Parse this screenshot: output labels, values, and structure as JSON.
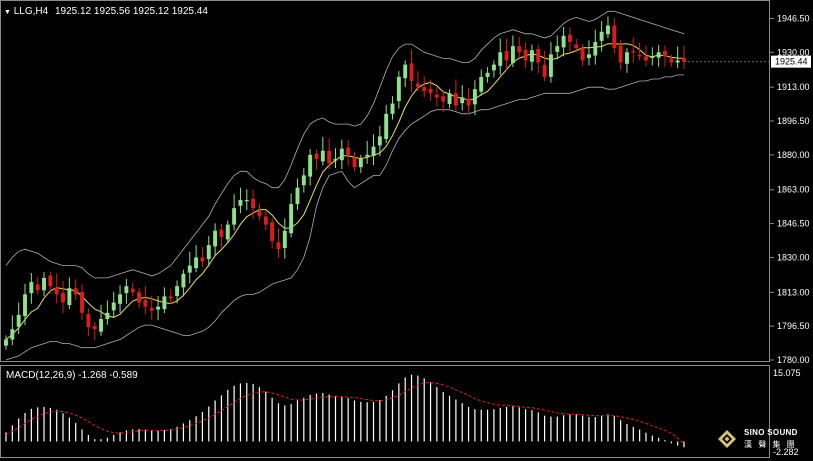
{
  "header": {
    "symbol": "LLG,H4",
    "ohlc": "1925.12 1925.56 1925.12 1925.44",
    "macd_label": "MACD(12,26,9) -1.268 -0.589"
  },
  "colors": {
    "background": "#000000",
    "grid": "#3a3a3a",
    "bull": "#8fe08f",
    "bear": "#d91c1c",
    "ma": "#e8e060",
    "bands": "#b0b0b0",
    "macd_hist": "#ffffff",
    "macd_signal": "#e02020",
    "text": "#ffffff",
    "price_tag_bg": "#ffffff",
    "price_tag_text": "#000000"
  },
  "logo": {
    "line1": "SINO SOUND",
    "line2": "漢 聲 集 團"
  },
  "chart_data": [
    {
      "type": "candlestick",
      "title": "LLG,H4",
      "ylim": [
        1780.0,
        1955.0
      ],
      "y_ticks": [
        "1946.50",
        "1930.00",
        "1913.00",
        "1896.50",
        "1880.00",
        "1863.00",
        "1846.50",
        "1830.00",
        "1813.00",
        "1796.50",
        "1780.00"
      ],
      "current_price": "1925.44",
      "indicators": [
        "Bollinger Bands",
        "Moving Average"
      ],
      "close": [
        1790,
        1795,
        1802,
        1812,
        1818,
        1814,
        1820,
        1816,
        1812,
        1808,
        1815,
        1812,
        1803,
        1796,
        1795,
        1800,
        1803,
        1808,
        1812,
        1816,
        1813,
        1808,
        1806,
        1804,
        1806,
        1811,
        1810,
        1816,
        1822,
        1826,
        1830,
        1828,
        1836,
        1843,
        1840,
        1846,
        1854,
        1858,
        1858,
        1854,
        1850,
        1846,
        1838,
        1834,
        1843,
        1856,
        1864,
        1870,
        1880,
        1878,
        1882,
        1876,
        1878,
        1883,
        1880,
        1874,
        1878,
        1880,
        1884,
        1889,
        1900,
        1905,
        1918,
        1924,
        1916,
        1913,
        1911,
        1910,
        1908,
        1906,
        1910,
        1904,
        1908,
        1904,
        1912,
        1918,
        1920,
        1924,
        1930,
        1926,
        1933,
        1930,
        1926,
        1931,
        1925,
        1918,
        1929,
        1933,
        1938,
        1935,
        1932,
        1926,
        1929,
        1935,
        1940,
        1943,
        1932,
        1925,
        1930,
        1930,
        1928,
        1926,
        1928,
        1930,
        1928,
        1925,
        1926,
        1925.44
      ],
      "bb_upper": [
        1826,
        1830,
        1833,
        1834,
        1833,
        1832,
        1830,
        1828,
        1827,
        1826,
        1826,
        1826,
        1825,
        1822,
        1820,
        1820,
        1820,
        1821,
        1822,
        1823,
        1824,
        1823,
        1822,
        1821,
        1822,
        1824,
        1826,
        1830,
        1834,
        1838,
        1842,
        1846,
        1850,
        1856,
        1861,
        1866,
        1870,
        1872,
        1872,
        1869,
        1867,
        1866,
        1864,
        1864,
        1868,
        1875,
        1883,
        1890,
        1895,
        1897,
        1898,
        1896,
        1895,
        1895,
        1895,
        1894,
        1895,
        1899,
        1905,
        1913,
        1921,
        1928,
        1932,
        1934,
        1934,
        1932,
        1930,
        1929,
        1928,
        1927,
        1927,
        1926,
        1925,
        1925,
        1927,
        1931,
        1934,
        1937,
        1939,
        1940,
        1941,
        1940,
        1939,
        1939,
        1938,
        1937,
        1938,
        1941,
        1944,
        1946,
        1947,
        1946,
        1945,
        1946,
        1948,
        1950,
        1950,
        1949,
        1948,
        1947,
        1946,
        1945,
        1944,
        1943,
        1942,
        1941,
        1940,
        1939
      ],
      "bb_lower": [
        1780,
        1781,
        1782,
        1784,
        1786,
        1787,
        1788,
        1789,
        1789,
        1788,
        1788,
        1787,
        1786,
        1786,
        1786,
        1787,
        1788,
        1789,
        1790,
        1792,
        1794,
        1796,
        1797,
        1797,
        1796,
        1795,
        1794,
        1793,
        1792,
        1792,
        1793,
        1794,
        1796,
        1799,
        1803,
        1806,
        1809,
        1811,
        1812,
        1812,
        1813,
        1815,
        1817,
        1818,
        1819,
        1820,
        1824,
        1830,
        1840,
        1855,
        1864,
        1870,
        1871,
        1872,
        1867,
        1864,
        1866,
        1868,
        1870,
        1870,
        1875,
        1882,
        1888,
        1892,
        1895,
        1897,
        1899,
        1901,
        1902,
        1902,
        1902,
        1901,
        1900,
        1900,
        1901,
        1902,
        1902,
        1903,
        1904,
        1905,
        1906,
        1907,
        1907,
        1908,
        1909,
        1910,
        1910,
        1910,
        1910,
        1910,
        1911,
        1912,
        1913,
        1913,
        1913,
        1912,
        1912,
        1913,
        1914,
        1915,
        1916,
        1916,
        1917,
        1917,
        1918,
        1918,
        1919,
        1919
      ]
    },
    {
      "type": "bar",
      "title": "MACD(12,26,9)",
      "series": [
        {
          "name": "MACD",
          "values": [
            2.0,
            3.5,
            5.0,
            6.2,
            7.1,
            7.4,
            7.5,
            7.3,
            6.9,
            6.1,
            5.2,
            4.0,
            2.6,
            1.4,
            0.5,
            0.5,
            0.8,
            1.4,
            2.0,
            2.4,
            2.6,
            2.7,
            2.6,
            2.4,
            2.3,
            2.5,
            2.7,
            3.2,
            3.9,
            4.6,
            5.5,
            6.4,
            7.6,
            8.9,
            10.0,
            11.2,
            12.1,
            12.6,
            12.7,
            12.5,
            11.8,
            10.8,
            9.5,
            8.3,
            7.8,
            8.1,
            8.9,
            9.5,
            10.1,
            10.4,
            10.5,
            10.2,
            9.9,
            9.7,
            9.4,
            8.9,
            8.6,
            8.5,
            8.6,
            9.0,
            9.9,
            11.1,
            12.6,
            13.9,
            14.5,
            14.3,
            13.7,
            12.8,
            11.8,
            10.7,
            9.9,
            9.1,
            8.3,
            7.5,
            7.0,
            6.9,
            6.9,
            7.0,
            7.3,
            7.5,
            7.6,
            7.4,
            7.0,
            6.8,
            6.3,
            5.6,
            5.4,
            5.4,
            5.7,
            5.9,
            5.9,
            5.6,
            5.3,
            5.3,
            5.6,
            5.9,
            5.5,
            4.6,
            3.8,
            3.2,
            2.6,
            1.9,
            1.3,
            0.8,
            0.3,
            -0.4,
            -0.9,
            -1.268
          ]
        },
        {
          "name": "Signal",
          "values": [
            1.5,
            2.2,
            3.0,
            3.9,
            4.8,
            5.5,
            6.0,
            6.4,
            6.6,
            6.5,
            6.2,
            5.7,
            5.1,
            4.3,
            3.5,
            2.8,
            2.2,
            1.9,
            1.8,
            1.9,
            2.1,
            2.3,
            2.4,
            2.4,
            2.4,
            2.4,
            2.5,
            2.7,
            3.0,
            3.4,
            3.9,
            4.5,
            5.1,
            5.9,
            6.7,
            7.6,
            8.5,
            9.3,
            10.0,
            10.5,
            10.7,
            10.8,
            10.5,
            10.1,
            9.6,
            9.2,
            9.0,
            9.0,
            9.2,
            9.4,
            9.6,
            9.7,
            9.7,
            9.7,
            9.6,
            9.5,
            9.3,
            9.1,
            8.9,
            8.8,
            9.0,
            9.4,
            10.0,
            10.8,
            11.6,
            12.3,
            12.7,
            12.8,
            12.6,
            12.3,
            11.8,
            11.2,
            10.6,
            10.0,
            9.3,
            8.8,
            8.4,
            8.1,
            7.9,
            7.8,
            7.7,
            7.6,
            7.4,
            7.3,
            7.1,
            6.8,
            6.5,
            6.2,
            6.0,
            5.9,
            5.9,
            5.8,
            5.7,
            5.6,
            5.6,
            5.6,
            5.6,
            5.4,
            5.1,
            4.8,
            4.4,
            3.9,
            3.4,
            2.9,
            2.4,
            1.8,
            0.8,
            -0.589
          ]
        }
      ],
      "ylim": [
        -2.282,
        15.075
      ],
      "y_ticks": [
        "15.075",
        "-2.282"
      ]
    }
  ]
}
